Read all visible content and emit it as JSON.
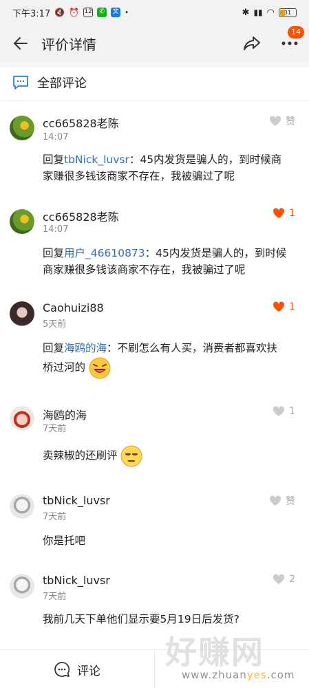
{
  "status_bar": {
    "time": "下午3:17",
    "battery": "31"
  },
  "header": {
    "title": "评价详情",
    "badge_count": "14"
  },
  "section": {
    "title": "全部评论"
  },
  "comments": [
    {
      "user": "cc665828老陈",
      "time": "14:07",
      "like": "赞",
      "liked": false,
      "reply_prefix": "回复",
      "reply_to": "tbNick_luvsr",
      "line1_rest": "：45内发货是骗人的，到时候商",
      "line2": "家赚很多钱该商家不存在，我被骗过了呢"
    },
    {
      "user": "cc665828老陈",
      "time": "14:07",
      "like": "1",
      "liked": true,
      "reply_prefix": "回复",
      "reply_to": "用户_46610873",
      "line1_rest": "：45内发货是骗人的，到时候",
      "line2": "商家赚很多钱该商家不存在，我被骗过了呢"
    },
    {
      "user": "Caohuizi88",
      "time": "5天前",
      "like": "1",
      "liked": true,
      "reply_prefix": "回复",
      "reply_to": "海鸥的海",
      "line1_rest": "：不刷怎么有人买，消费者都喜欢扶",
      "line2": "桥过河的",
      "emoji": "laughing-emoji"
    },
    {
      "user": "海鸥的海",
      "time": "7天前",
      "like": "1",
      "liked": false,
      "text": "卖辣椒的还刷评",
      "emoji": "unamused-emoji"
    },
    {
      "user": "tbNick_luvsr",
      "time": "7天前",
      "like": "赞",
      "liked": false,
      "text": "你是托吧"
    },
    {
      "user": "tbNick_luvsr",
      "time": "7天前",
      "like": "2",
      "liked": false,
      "text": "我前几天下单他们显示要5月19日后发货?"
    }
  ],
  "bottom_bar": {
    "comment_label": "评论"
  },
  "watermark": {
    "big": "好赚网",
    "small_a": "www.zhuan",
    "small_b": "yes",
    "small_c": ".com"
  },
  "colors": {
    "accent": "#ff5000",
    "link": "#2f6fb5",
    "muted": "#888888"
  }
}
